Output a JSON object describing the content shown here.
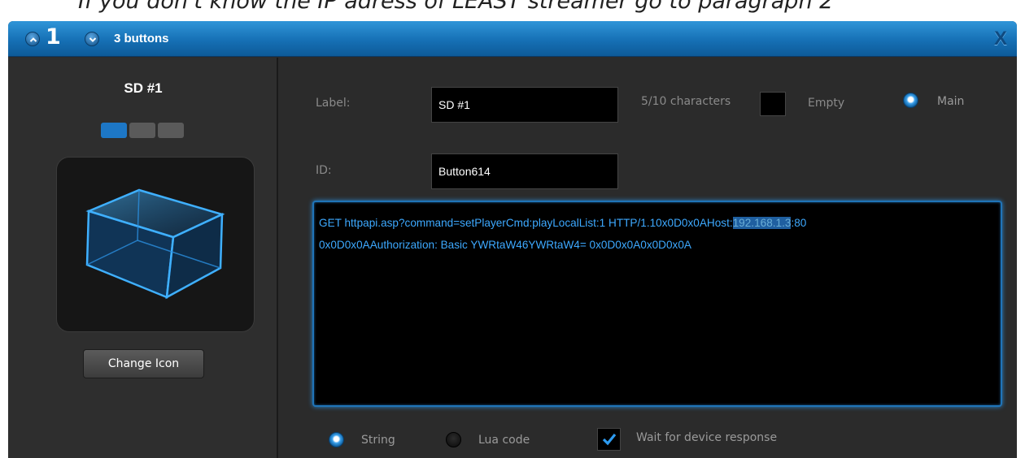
{
  "caption": {
    "text": "If you don't know the IP adress of LEAST streamer go to paragraph 2"
  },
  "titlebar": {
    "page_number": "1",
    "count_label": "3 buttons",
    "close_label": "X"
  },
  "left_panel": {
    "button_name": "SD #1",
    "states": [
      "active",
      "inactive",
      "inactive"
    ],
    "change_icon_label": "Change Icon"
  },
  "form": {
    "label_caption": "Label:",
    "label_value": "SD #1",
    "char_count": "5/10 characters",
    "empty_label": "Empty",
    "main_label": "Main",
    "id_caption": "ID:",
    "id_value": "Button614"
  },
  "command": {
    "line1_before": "GET httpapi.asp?command=setPlayerCmd:playLocalList:1 HTTP/1.10x0D0x0AHost:",
    "line1_selected": "192.168.1.3",
    "line1_after": ":80",
    "line2": "0x0D0x0AAuthorization: Basic YWRtaW46YWRtaW4= 0x0D0x0A0x0D0x0A"
  },
  "options": {
    "string_label": "String",
    "lua_label": "Lua code",
    "wait_label": "Wait for device response",
    "mode_selected": "String",
    "wait_checked": true
  },
  "colors": {
    "accent": "#1f74b8",
    "titlebar": "#1670b5",
    "text_blue": "#3da9ff"
  }
}
